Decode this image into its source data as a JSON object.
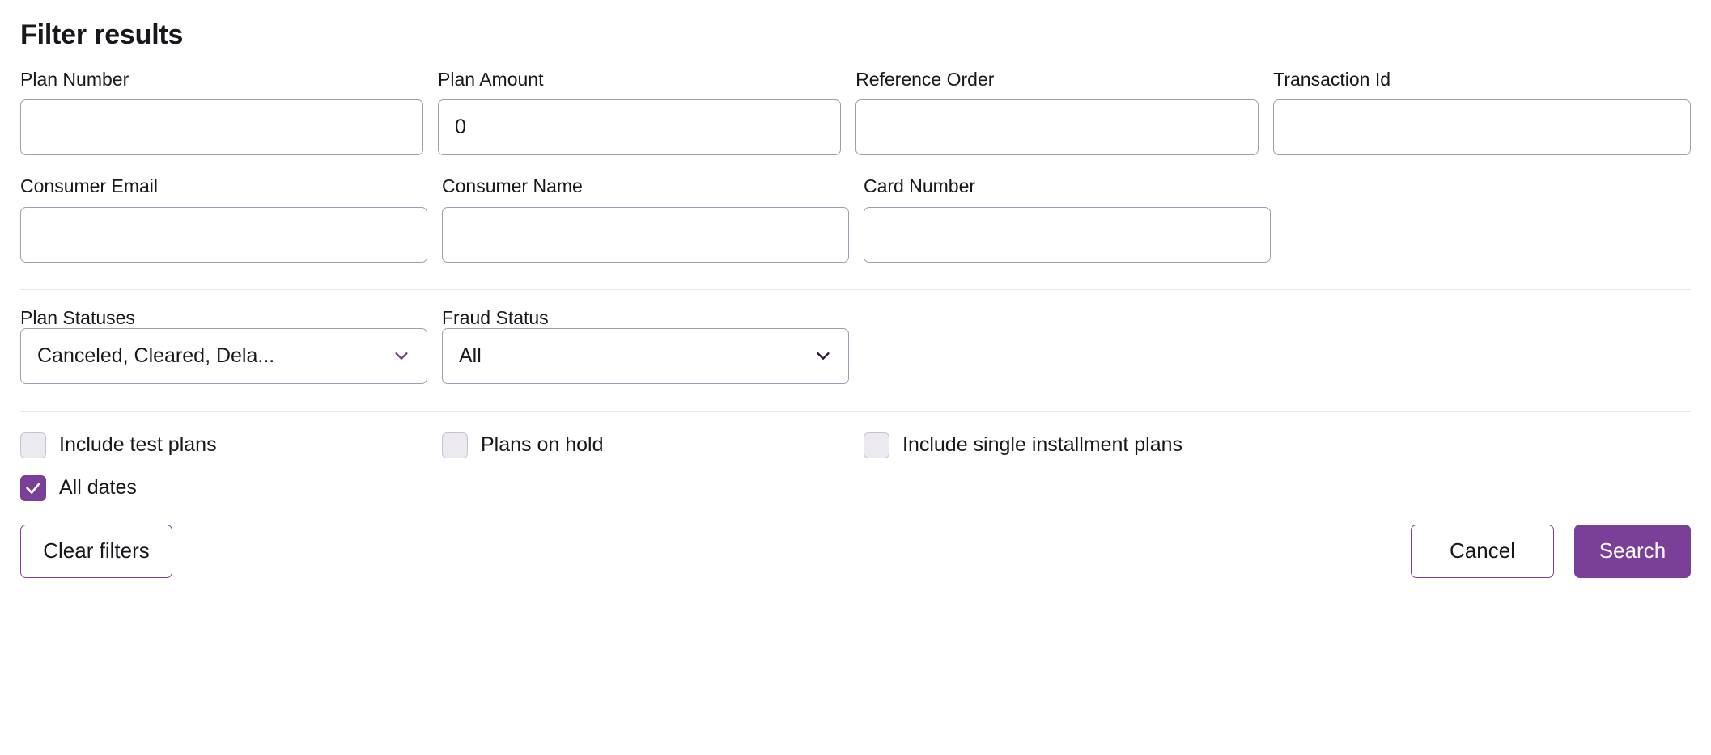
{
  "panel": {
    "title": "Filter results"
  },
  "fields": {
    "row1": [
      {
        "label": "Plan Number",
        "value": "",
        "placeholder": ""
      },
      {
        "label": "Plan Amount",
        "value": "0",
        "placeholder": ""
      },
      {
        "label": "Reference Order",
        "value": "",
        "placeholder": ""
      },
      {
        "label": "Transaction Id",
        "value": "",
        "placeholder": ""
      }
    ],
    "row2": [
      {
        "label": "Consumer Email",
        "value": "",
        "placeholder": ""
      },
      {
        "label": "Consumer Name",
        "value": "",
        "placeholder": ""
      },
      {
        "label": "Card Number",
        "value": "",
        "placeholder": ""
      }
    ]
  },
  "selects": [
    {
      "label": "Plan Statuses",
      "value": "Canceled, Cleared, Dela...",
      "icon": "chevron-down-icon",
      "icon_color": "#7a3f98"
    },
    {
      "label": "Fraud Status",
      "value": "All",
      "icon": "chevron-down-icon",
      "icon_color": "#2b1333"
    }
  ],
  "checkboxes": {
    "row1": [
      {
        "label": "Include test plans",
        "checked": false
      },
      {
        "label": "Plans on hold",
        "checked": false
      },
      {
        "label": "Include single installment plans",
        "checked": false
      }
    ],
    "row2": [
      {
        "label": "All dates",
        "checked": true
      }
    ]
  },
  "buttons": {
    "clear": "Clear filters",
    "cancel": "Cancel",
    "search": "Search"
  },
  "colors": {
    "accent": "#7a3f98",
    "input_border": "#9aa1ae",
    "divider": "#e6e6ec",
    "checkbox_unchecked_bg": "#ece9f1",
    "text": "#17171c"
  }
}
